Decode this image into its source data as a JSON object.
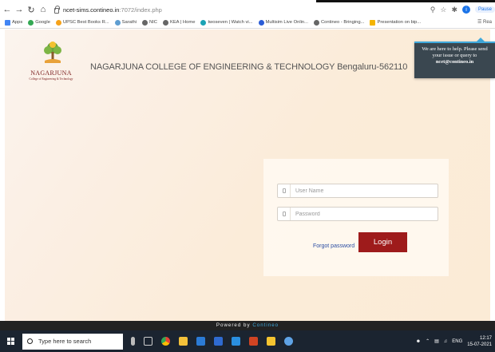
{
  "browser": {
    "url_host": "ncet-sims.contineo.in",
    "url_path": ":7072/index.php",
    "pause_label": "Pause",
    "profile_initial": "i",
    "bookmarks": [
      {
        "label": "Apps",
        "color": "#4285f4"
      },
      {
        "label": "Google",
        "color": "#34a853"
      },
      {
        "label": "UPSC Best Books R...",
        "color": "#f6a21a"
      },
      {
        "label": "Sarathi",
        "color": "#5f9ed1"
      },
      {
        "label": "NIC",
        "color": "#666666"
      },
      {
        "label": "KEA | Home",
        "color": "#666666"
      },
      {
        "label": "twoseven | Watch vi...",
        "color": "#1ba3b5"
      },
      {
        "label": "Multisim Live Onlin...",
        "color": "#2a5cd6"
      },
      {
        "label": "Contineo - Bringing...",
        "color": "#666666"
      },
      {
        "label": "Presentation on bip...",
        "color": "#f4b400"
      }
    ],
    "reading_list": "Rea"
  },
  "header": {
    "logo_name": "NAGARJUNA",
    "logo_sub": "College of Engineering & Technology",
    "college_title": "NAGARJUNA COLLEGE OF ENGINEERING & TECHNOLOGY Bengaluru-562110"
  },
  "help": {
    "line1": "We are here to help. Please send",
    "line2": "your issue or query to",
    "email": "ncet@contineo.in"
  },
  "login": {
    "username_placeholder": "User Name",
    "password_placeholder": "Password",
    "forgot_label": "Forgot password",
    "login_label": "Login"
  },
  "footer": {
    "powered_prefix": "Powered by",
    "powered_brand": "Contineo"
  },
  "taskbar": {
    "search_placeholder": "Type here to search",
    "language": "ENG",
    "time": "12:17",
    "date": "15-07-2021"
  },
  "colors": {
    "accent_maroon": "#9e1b1b",
    "help_box_bg": "#3a4750",
    "help_accent": "#3fa9dc",
    "link_blue": "#2b4ea3"
  }
}
